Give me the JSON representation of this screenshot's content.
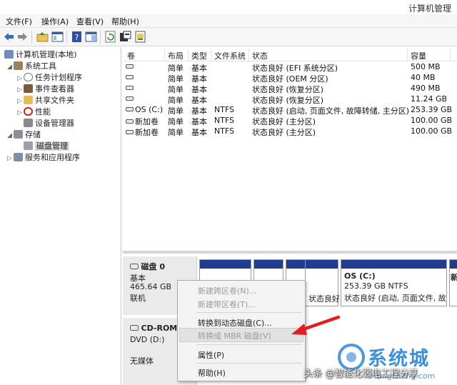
{
  "window": {
    "title": "计算机管理"
  },
  "menu": [
    "文件(F)",
    "操作(A)",
    "查看(V)",
    "帮助(H)"
  ],
  "toolbar": {
    "buttons": [
      "back-arrow",
      "forward-arrow",
      "up-folder",
      "show-tree",
      "help",
      "show-pane",
      "refresh",
      "properties",
      "export"
    ]
  },
  "tree": {
    "root": "计算机管理(本地)",
    "system_tools": "系统工具",
    "task_scheduler": "任务计划程序",
    "event_viewer": "事件查看器",
    "shared_folders": "共享文件夹",
    "performance": "性能",
    "device_manager": "设备管理器",
    "storage": "存储",
    "disk_management": "磁盘管理",
    "services_apps": "服务和应用程序"
  },
  "volumes": {
    "headers": [
      "卷",
      "布局",
      "类型",
      "文件系统",
      "状态",
      "容量"
    ],
    "rows": [
      {
        "vol": "",
        "layout": "简单",
        "type": "基本",
        "fs": "",
        "status": "状态良好 (EFI 系统分区)",
        "capacity": "500 MB"
      },
      {
        "vol": "",
        "layout": "简单",
        "type": "基本",
        "fs": "",
        "status": "状态良好 (OEM 分区)",
        "capacity": "40 MB"
      },
      {
        "vol": "",
        "layout": "简单",
        "type": "基本",
        "fs": "",
        "status": "状态良好 (恢复分区)",
        "capacity": "490 MB"
      },
      {
        "vol": "",
        "layout": "简单",
        "type": "基本",
        "fs": "",
        "status": "状态良好 (恢复分区)",
        "capacity": "11.24 GB"
      },
      {
        "vol": "OS (C:)",
        "layout": "简单",
        "type": "基本",
        "fs": "NTFS",
        "status": "状态良好 (启动, 页面文件, 故障转储, 主分区)",
        "capacity": "253.39 GB"
      },
      {
        "vol": "新加卷",
        "layout": "简单",
        "type": "基本",
        "fs": "NTFS",
        "status": "状态良好 (主分区)",
        "capacity": "100.00 GB"
      },
      {
        "vol": "新加卷",
        "layout": "简单",
        "type": "基本",
        "fs": "NTFS",
        "status": "状态良好 (主分区)",
        "capacity": "100.00 GB"
      }
    ]
  },
  "disk0": {
    "name": "磁盘 0",
    "type": "基本",
    "size": "465.64 GB",
    "state": "联机"
  },
  "cdrom": {
    "name": "CD-ROM",
    "drive": "DVD (D:)",
    "media": "无媒体"
  },
  "partitions": {
    "p4_text": "状态良好 (恢",
    "os_name": "OS (C:)",
    "os_size": "253.39 GB NTFS",
    "os_status": "状态良好 (启动, 页面文件, 故",
    "last_name": "新"
  },
  "context_menu": {
    "new_spanned": "新建跨区卷(N)...",
    "new_striped": "新建带区卷(T)...",
    "to_dynamic": "转换到动态磁盘(C)...",
    "to_mbr": "转换成 MBR 磁盘(V)",
    "properties": "属性(P)",
    "help": "帮助(H)"
  },
  "watermark": {
    "caption": "头条 @智能化弱电工程分享",
    "logo": "系统城",
    "site": "xitongcheng.com"
  },
  "colors": {
    "partition_bar": "#1f3c8f",
    "arrow": "#e02020",
    "logo": "#2e86d8"
  }
}
